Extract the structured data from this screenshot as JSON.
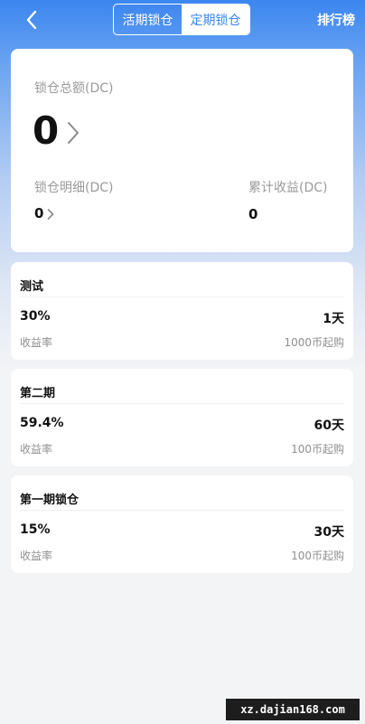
{
  "header": {
    "back_icon": "chevron-left-icon",
    "tabs": [
      {
        "label": "活期锁仓",
        "active": false
      },
      {
        "label": "定期锁仓",
        "active": true
      }
    ],
    "rank_label": "排行榜"
  },
  "summary": {
    "total_label": "锁仓总额(DC)",
    "total_value": "0",
    "detail_label": "锁仓明细(DC)",
    "detail_value": "0",
    "earnings_label": "累计收益(DC)",
    "earnings_value": "0"
  },
  "plans": [
    {
      "name": "测试",
      "rate": "30%",
      "rate_label": "收益率",
      "days": "1天",
      "min": "1000币起购"
    },
    {
      "name": "第二期",
      "rate": "59.4%",
      "rate_label": "收益率",
      "days": "60天",
      "min": "100币起购"
    },
    {
      "name": "第一期锁仓",
      "rate": "15%",
      "rate_label": "收益率",
      "days": "30天",
      "min": "100币起购"
    }
  ],
  "watermark": "xz.dajian168.com",
  "colors": {
    "accent": "#3b86f0",
    "card_bg": "#ffffff",
    "page_bg": "#f3f4f6"
  }
}
